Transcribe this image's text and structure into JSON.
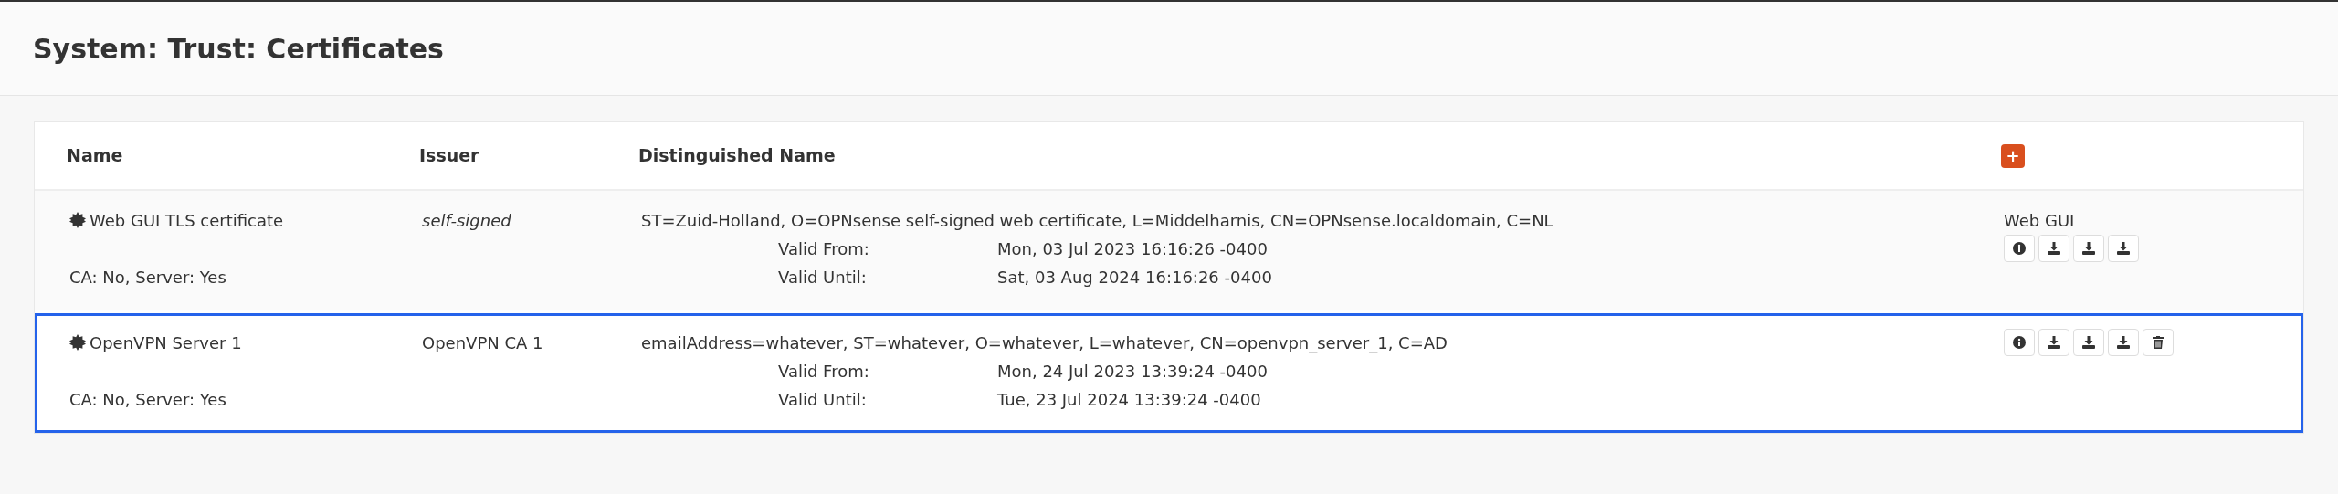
{
  "page_title": "System: Trust: Certificates",
  "table": {
    "columns": [
      "Name",
      "Issuer",
      "Distinguished Name"
    ],
    "add_button": "+",
    "rows": [
      {
        "name": "Web GUI TLS certificate",
        "issuer": "self-signed",
        "issuer_italic": true,
        "flags": "CA: No, Server: Yes",
        "dn": "ST=Zuid-Holland, O=OPNsense self-signed web certificate, L=Middelharnis, CN=OPNsense.localdomain, C=NL",
        "valid_from_label": "Valid From:",
        "valid_from": "Mon, 03 Jul 2023 16:16:26 -0400",
        "valid_until_label": "Valid Until:",
        "valid_until": "Sat, 03 Aug 2024 16:16:26 -0400",
        "in_use": "Web GUI",
        "selected": false,
        "actions": [
          {
            "kind": "info"
          },
          {
            "kind": "download"
          },
          {
            "kind": "download"
          },
          {
            "kind": "download"
          }
        ]
      },
      {
        "name": "OpenVPN Server 1",
        "issuer": "OpenVPN CA 1",
        "issuer_italic": false,
        "flags": "CA: No, Server: Yes",
        "dn": "emailAddress=whatever, ST=whatever, O=whatever, L=whatever, CN=openvpn_server_1, C=AD",
        "valid_from_label": "Valid From:",
        "valid_from": "Mon, 24 Jul 2023 13:39:24 -0400",
        "valid_until_label": "Valid Until:",
        "valid_until": "Tue, 23 Jul 2024 13:39:24 -0400",
        "selected": true,
        "actions": [
          {
            "kind": "info"
          },
          {
            "kind": "download"
          },
          {
            "kind": "download"
          },
          {
            "kind": "download"
          },
          {
            "kind": "delete"
          }
        ]
      }
    ]
  }
}
